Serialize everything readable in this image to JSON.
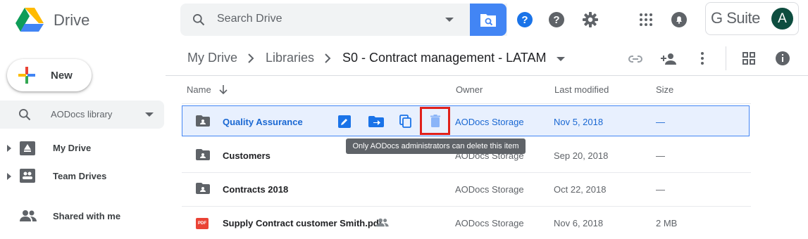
{
  "app": {
    "name": "Drive"
  },
  "search": {
    "placeholder": "Search Drive"
  },
  "header": {
    "suite_label": "G Suite",
    "avatar_initial": "A"
  },
  "sidebar": {
    "new_label": "New",
    "library_selector": "AODocs library",
    "items": [
      {
        "label": "My Drive"
      },
      {
        "label": "Team Drives"
      },
      {
        "label": "Shared with me"
      }
    ]
  },
  "breadcrumb": [
    "My Drive",
    "Libraries",
    "S0 - Contract management - LATAM"
  ],
  "table": {
    "columns": {
      "name": "Name",
      "owner": "Owner",
      "modified": "Last modified",
      "size": "Size"
    },
    "rows": [
      {
        "name": "Quality Assurance",
        "owner": "AODocs Storage",
        "modified": "Nov 5, 2018",
        "size": "—",
        "type": "folder",
        "selected": true
      },
      {
        "name": "Customers",
        "owner": "AODocs Storage",
        "modified": "Sep 20, 2018",
        "size": "—",
        "type": "folder"
      },
      {
        "name": "Contracts 2018",
        "owner": "AODocs Storage",
        "modified": "Oct 22, 2018",
        "size": "—",
        "type": "folder"
      },
      {
        "name": "Supply Contract customer Smith.pdf",
        "owner": "AODocs Storage",
        "modified": "Nov 6, 2018",
        "size": "2 MB",
        "type": "pdf",
        "shared": true,
        "file_badge": "PDF"
      }
    ]
  },
  "tooltip": "Only AODocs administrators can delete this item",
  "colors": {
    "accent": "#4285f4",
    "selected_bg": "#e8f0fe",
    "highlight": "#e0201b",
    "avatar": "#0d4d3f"
  }
}
